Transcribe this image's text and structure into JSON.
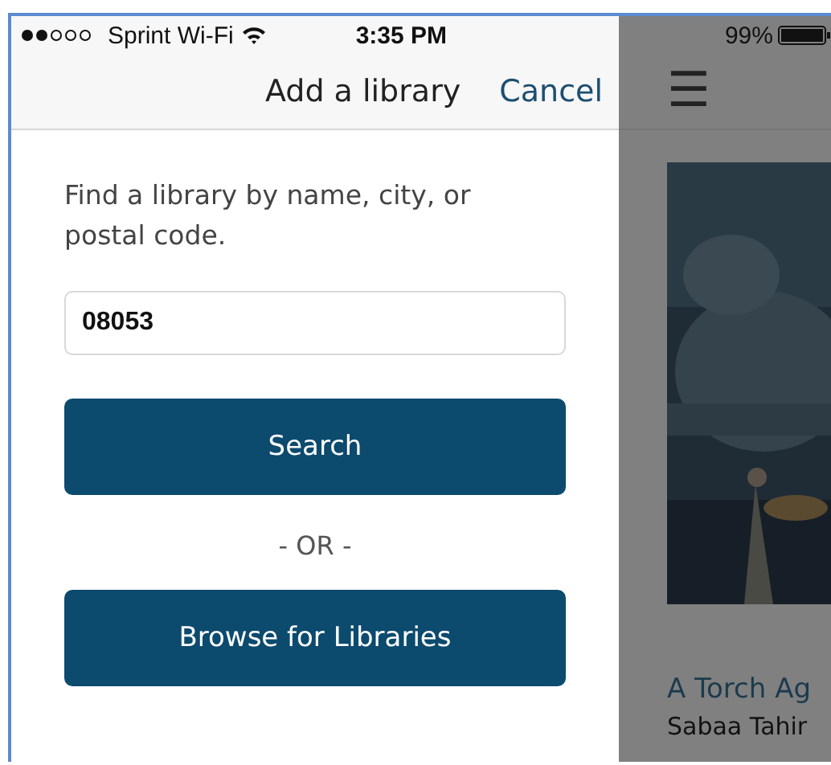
{
  "status_bar": {
    "carrier": "Sprint Wi-Fi",
    "time": "3:35 PM",
    "battery": "99%"
  },
  "panel": {
    "title": "Add a library",
    "cancel": "Cancel",
    "prompt": "Find a library by name, city, or postal code.",
    "search_field": {
      "value": "08053"
    },
    "search_button": "Search",
    "separator": "- OR -",
    "browse_button": "Browse for Libraries"
  },
  "background": {
    "menu_icon": "☰",
    "book": {
      "kind": "picture",
      "title": "A Torch Ag",
      "author": "Sabaa Tahir"
    }
  }
}
